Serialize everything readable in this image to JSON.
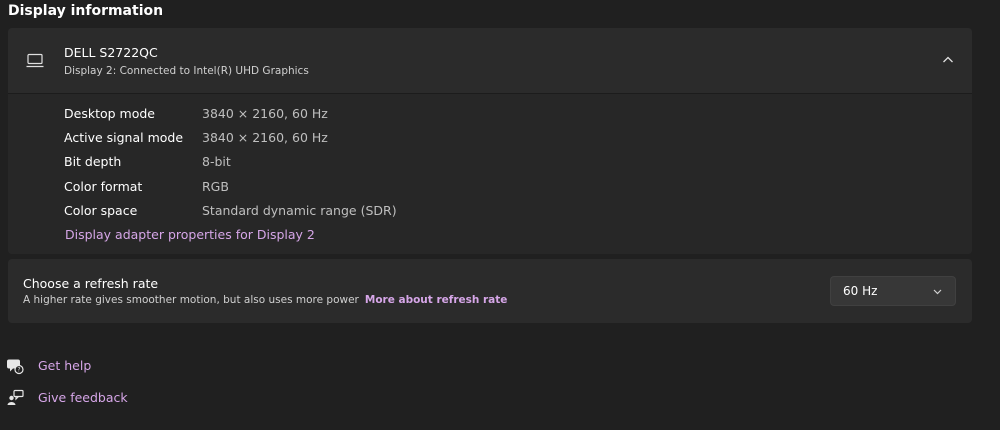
{
  "section": {
    "heading": "Display information"
  },
  "display": {
    "name": "DELL S2722QC",
    "subtitle": "Display 2: Connected to Intel(R) UHD Graphics",
    "icon": "monitor-icon",
    "expanded": true,
    "details": [
      {
        "label": "Desktop mode",
        "value": "3840 × 2160, 60 Hz"
      },
      {
        "label": "Active signal mode",
        "value": "3840 × 2160, 60 Hz"
      },
      {
        "label": "Bit depth",
        "value": "8-bit"
      },
      {
        "label": "Color format",
        "value": "RGB"
      },
      {
        "label": "Color space",
        "value": "Standard dynamic range (SDR)"
      }
    ],
    "adapter_link": "Display adapter properties for Display 2"
  },
  "refresh": {
    "title": "Choose a refresh rate",
    "description": "A higher rate gives smoother motion, but also uses more power",
    "link": "More about refresh rate",
    "selected": "60 Hz"
  },
  "help": {
    "get_help": "Get help",
    "give_feedback": "Give feedback"
  },
  "colors": {
    "background": "#202020",
    "card": "#2b2b2b",
    "accent_link": "#d6a6e8",
    "text": "#ffffff",
    "muted_text": "#bfbfbf"
  }
}
